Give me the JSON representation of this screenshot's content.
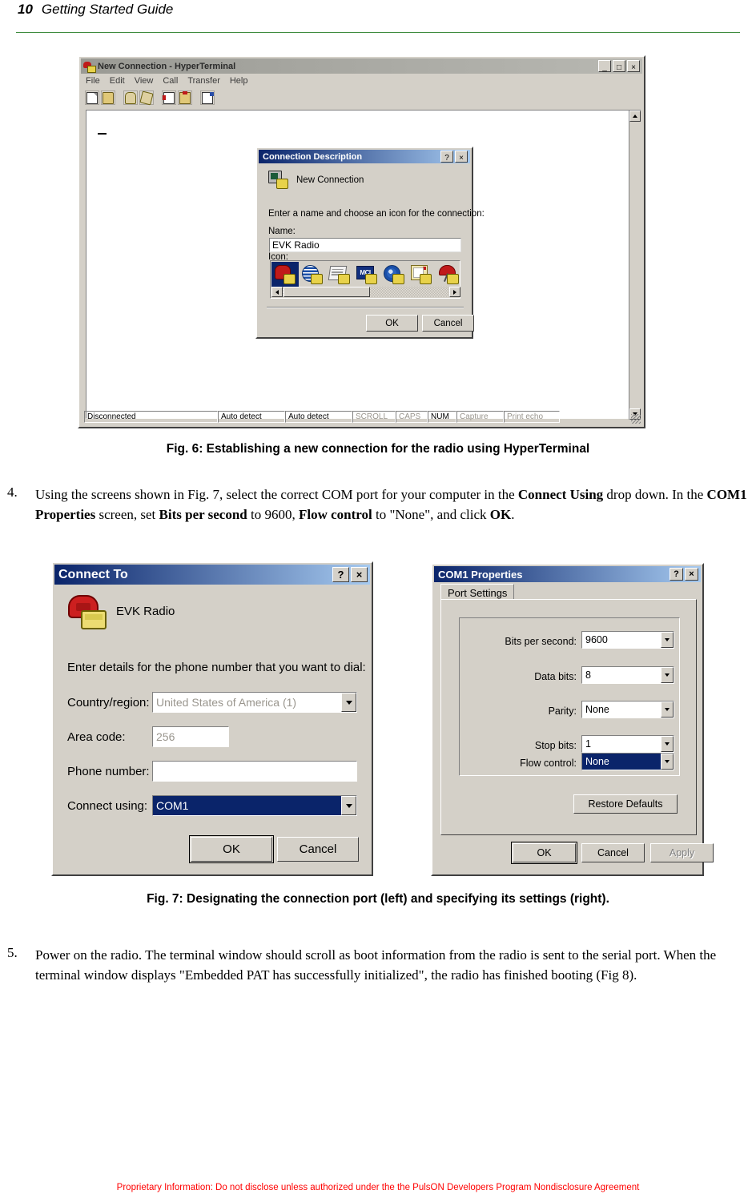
{
  "header": {
    "page_number": "10",
    "title": "Getting Started Guide",
    "rule_color": "#3c8a3c"
  },
  "hyperterminal": {
    "title": "New Connection - HyperTerminal",
    "menu": [
      "File",
      "Edit",
      "View",
      "Call",
      "Transfer",
      "Help"
    ],
    "window_buttons": {
      "minimize": "_",
      "maximize": "□",
      "close": "×"
    },
    "toolbar_icons": [
      "new-document-icon",
      "open-folder-icon",
      "call-phone-icon",
      "disconnect-icon",
      "send-file-icon",
      "receive-file-icon",
      "properties-icon"
    ],
    "terminal_cursor": "_",
    "status": [
      {
        "label": "Disconnected",
        "active": true
      },
      {
        "label": "Auto detect",
        "active": true
      },
      {
        "label": "Auto detect",
        "active": true
      },
      {
        "label": "SCROLL",
        "active": false
      },
      {
        "label": "CAPS",
        "active": false
      },
      {
        "label": "NUM",
        "active": true
      },
      {
        "label": "Capture",
        "active": false
      },
      {
        "label": "Print echo",
        "active": false
      }
    ]
  },
  "connection_description": {
    "title": "Connection Description",
    "help_button": "?",
    "close_button": "×",
    "icon_title": "New Connection",
    "prompt": "Enter a name and choose an icon for the connection:",
    "name_label": "Name:",
    "name_value": "EVK Radio",
    "icon_label": "Icon:",
    "icons": [
      "red-phone-icon",
      "blue-globe-icon",
      "paper-document-icon",
      "mci-icon",
      "world-network-icon",
      "notebook-icon",
      "red-kite-icon"
    ],
    "selected_icon_index": 0,
    "ok_label": "OK",
    "cancel_label": "Cancel"
  },
  "fig6": {
    "caption": "Fig. 6:  Establishing a new connection for the radio using HyperTerminal"
  },
  "step4": {
    "number": "4.",
    "segments": [
      {
        "text": "Using the screens shown in Fig. 7, select the correct COM port for your computer in the ",
        "bold": false
      },
      {
        "text": "Connect Using",
        "bold": true
      },
      {
        "text": "  drop down. In the ",
        "bold": false
      },
      {
        "text": "COM1 Properties",
        "bold": true
      },
      {
        "text": " screen, set ",
        "bold": false
      },
      {
        "text": "Bits per second",
        "bold": true
      },
      {
        "text": " to 9600, ",
        "bold": false
      },
      {
        "text": "Flow control",
        "bold": true
      },
      {
        "text": " to \"None\", and click ",
        "bold": false
      },
      {
        "text": "OK",
        "bold": true
      },
      {
        "text": ".",
        "bold": false
      }
    ]
  },
  "connect_to": {
    "title": "Connect To",
    "help_button": "?",
    "close_button": "×",
    "connection_name": "EVK Radio",
    "prompt": "Enter details for the phone number that you want to dial:",
    "fields": [
      {
        "label": "Country/region:",
        "value": "United States of America (1)",
        "state": "disabled",
        "type": "combobox"
      },
      {
        "label": "Area code:",
        "value": "256",
        "state": "disabled",
        "type": "text"
      },
      {
        "label": "Phone number:",
        "value": "",
        "state": "disabled",
        "type": "text"
      },
      {
        "label": "Connect using:",
        "value": "COM1",
        "state": "selected",
        "type": "combobox"
      }
    ],
    "ok_label": "OK",
    "cancel_label": "Cancel"
  },
  "com1_properties": {
    "title": "COM1 Properties",
    "help_button": "?",
    "close_button": "×",
    "tab_label": "Port Settings",
    "settings": [
      {
        "label": "Bits per second:",
        "value": "9600",
        "highlighted": false
      },
      {
        "label": "Data bits:",
        "value": "8",
        "highlighted": false
      },
      {
        "label": "Parity:",
        "value": "None",
        "highlighted": false
      },
      {
        "label": "Stop bits:",
        "value": "1",
        "highlighted": false
      },
      {
        "label": "Flow control:",
        "value": "None",
        "highlighted": true
      }
    ],
    "restore_defaults_label": "Restore Defaults",
    "ok_label": "OK",
    "cancel_label": "Cancel",
    "apply_label": "Apply",
    "apply_disabled": true
  },
  "fig7": {
    "caption": "Fig. 7:  Designating the connection port (left) and specifying its settings (right)."
  },
  "step5": {
    "number": "5.",
    "segments": [
      {
        "text": "Power on the radio. The terminal window should scroll as boot information from the radio is sent to the serial port. When the terminal window displays \"Embedded PAT has successfully initialized\", the radio has finished booting (Fig 8).",
        "bold": false
      }
    ]
  },
  "footer": {
    "text": "Proprietary Information:  Do not disclose unless authorized under the the PulsON Developers Program Nondisclosure Agreement",
    "color": "#ff0000"
  }
}
